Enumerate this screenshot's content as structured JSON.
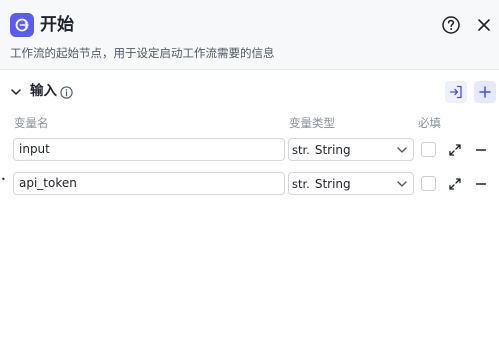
{
  "node": {
    "title": "开始",
    "description": "工作流的起始节点，用于设定启动工作流需要的信息",
    "icon": "start-node-icon",
    "accent_color": "#5a5cf0"
  },
  "section": {
    "title": "输入",
    "toggle_icon": "chevron-down-icon",
    "info_icon": "info-icon",
    "import_icon": "import-icon",
    "add_icon": "plus-icon"
  },
  "columns": {
    "name": "变量名",
    "type": "变量类型",
    "required": "必填"
  },
  "variables": [
    {
      "bullet": "•",
      "name": "",
      "type_prefix": "str.",
      "type": "String",
      "required": false
    },
    {
      "bullet": "•",
      "name": "api_token",
      "type_prefix": "str.",
      "type": "String",
      "required": false
    }
  ],
  "first_variable_name": "input",
  "header_actions": [
    "help-icon",
    "close-icon"
  ]
}
